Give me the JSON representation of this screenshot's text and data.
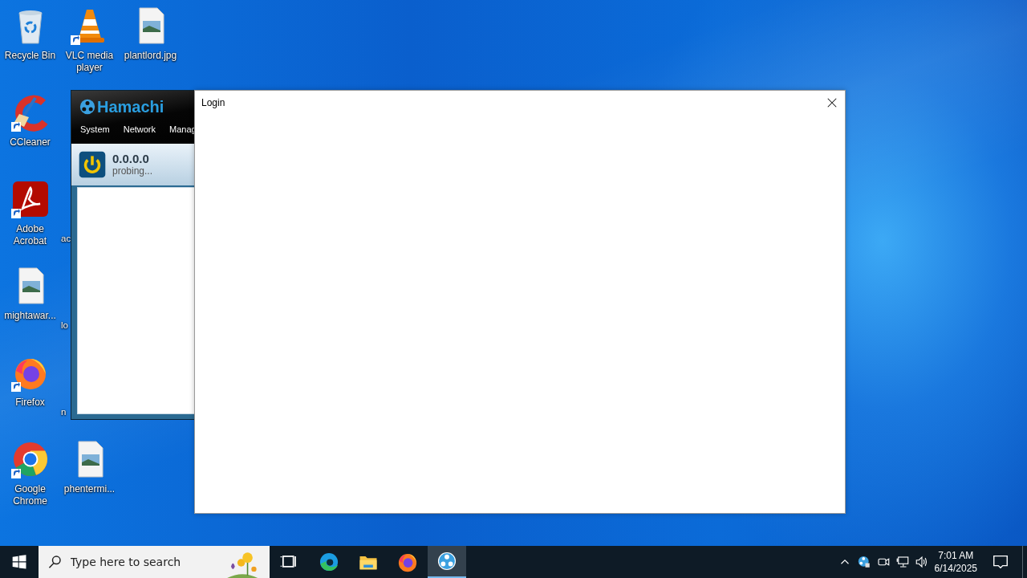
{
  "desktop": {
    "icons": [
      {
        "label": "Recycle Bin",
        "kind": "recycle",
        "shortcut": false
      },
      {
        "label": "VLC media player",
        "kind": "vlc",
        "shortcut": true
      },
      {
        "label": "plantlord.jpg",
        "kind": "image",
        "shortcut": false
      },
      {
        "label": "CCleaner",
        "kind": "ccleaner",
        "shortcut": true
      },
      {
        "label": "Adobe Acrobat",
        "kind": "acrobat",
        "shortcut": true
      },
      {
        "label": "ac",
        "kind": "partial",
        "shortcut": false
      },
      {
        "label": "mightawar...",
        "kind": "image",
        "shortcut": false
      },
      {
        "label": "lo",
        "kind": "partial",
        "shortcut": false
      },
      {
        "label": "Firefox",
        "kind": "firefox",
        "shortcut": true
      },
      {
        "label": "n",
        "kind": "partial",
        "shortcut": false
      },
      {
        "label": "Google Chrome",
        "kind": "chrome",
        "shortcut": true
      },
      {
        "label": "phentermi...",
        "kind": "image",
        "shortcut": false
      }
    ]
  },
  "hamachi": {
    "logo": "Hamachi",
    "menu": [
      "System",
      "Network",
      "Manag"
    ],
    "address": "0.0.0.0",
    "status": "probing..."
  },
  "login": {
    "title": "Login"
  },
  "taskbar": {
    "search": {
      "placeholder": "Type here to search"
    },
    "apps": [
      {
        "kind": "taskview",
        "active": false
      },
      {
        "kind": "edge",
        "active": false
      },
      {
        "kind": "explorer",
        "active": false
      },
      {
        "kind": "firefox",
        "active": false
      },
      {
        "kind": "hamachi",
        "active": true
      }
    ],
    "tray": [
      {
        "kind": "chevron"
      },
      {
        "kind": "hamachi"
      },
      {
        "kind": "meet"
      },
      {
        "kind": "network"
      },
      {
        "kind": "volume"
      }
    ],
    "time": "7:01 AM",
    "date": "6/14/2025"
  }
}
